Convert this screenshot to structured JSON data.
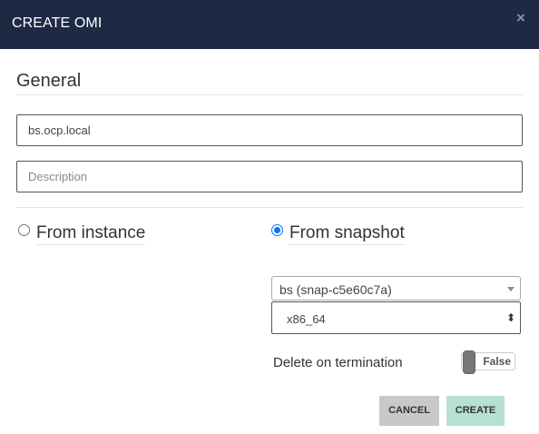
{
  "header": {
    "title": "CREATE OMI",
    "close_icon": "close-icon"
  },
  "section": {
    "title": "General"
  },
  "form": {
    "name_value": "bs.ocp.local",
    "description_placeholder": "Description",
    "source_options": [
      {
        "label": "From instance",
        "checked": false
      },
      {
        "label": "From snapshot",
        "checked": true
      }
    ],
    "snapshot_selected": "bs (snap-c5e60c7a)",
    "architecture_selected": "x86_64",
    "delete_on_termination_label": "Delete on termination",
    "delete_on_termination_value": "False"
  },
  "buttons": {
    "cancel_label": "CANCEL",
    "create_label": "CREATE"
  },
  "colors": {
    "header_bg": "#1e2a44",
    "create_bg": "#b6e0d0",
    "cancel_bg": "#c8c8c8",
    "radio_accent": "#0075ff"
  }
}
